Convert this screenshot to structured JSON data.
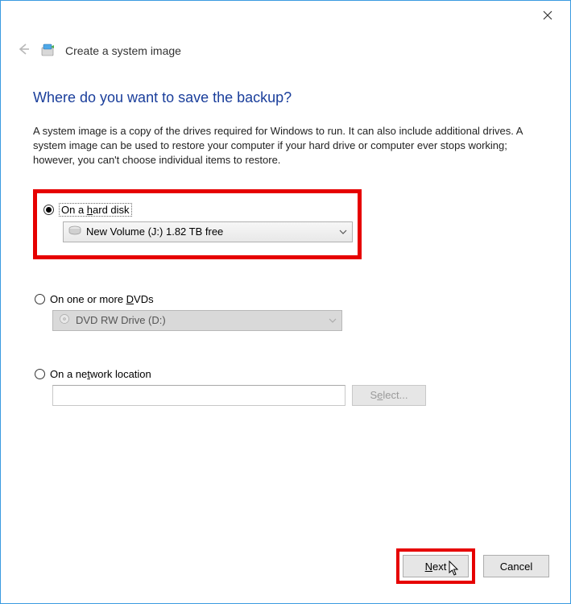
{
  "window": {
    "title": "Create a system image"
  },
  "main": {
    "heading": "Where do you want to save the backup?",
    "description": "A system image is a copy of the drives required for Windows to run. It can also include additional drives. A system image can be used to restore your computer if your hard drive or computer ever stops working; however, you can't choose individual items to restore."
  },
  "options": {
    "hard_disk": {
      "label_pre": "On a ",
      "label_u": "h",
      "label_post": "ard disk",
      "selected": true,
      "drive_label": "New Volume (J:)  1.82 TB free"
    },
    "dvd": {
      "label_pre": "On one or more ",
      "label_u": "D",
      "label_post": "VDs",
      "selected": false,
      "drive_label": "DVD RW Drive (D:)"
    },
    "network": {
      "label_pre": "On a ne",
      "label_u": "t",
      "label_post": "work location",
      "selected": false,
      "input_value": "",
      "select_btn_pre": "S",
      "select_btn_u": "e",
      "select_btn_post": "lect..."
    }
  },
  "footer": {
    "next_u": "N",
    "next_post": "ext",
    "cancel": "Cancel"
  }
}
